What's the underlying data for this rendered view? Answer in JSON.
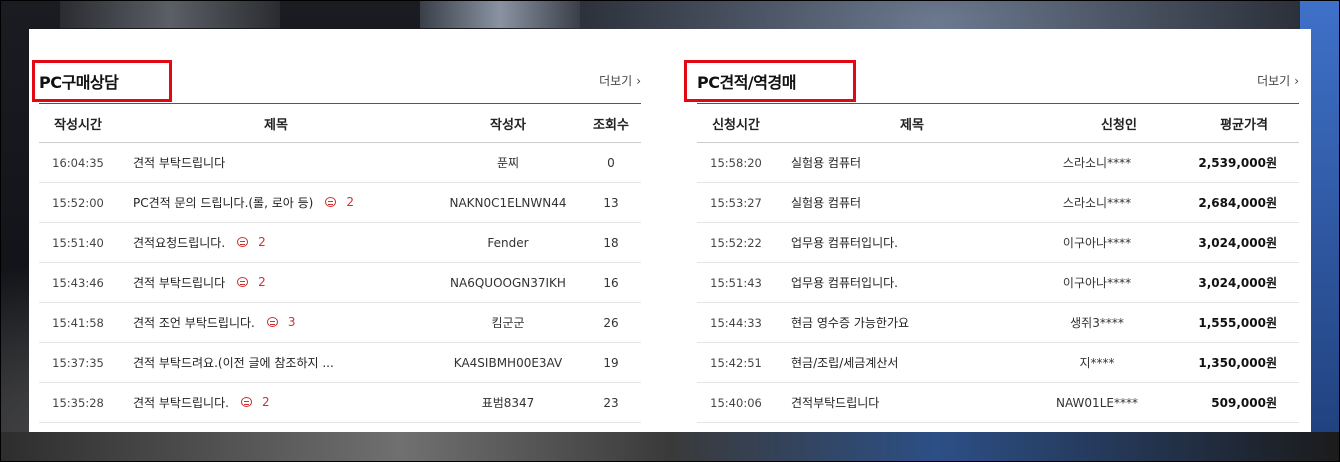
{
  "left_panel": {
    "title": "PC구매상담",
    "more": "더보기",
    "headers": [
      "작성시간",
      "제목",
      "작성자",
      "조회수"
    ],
    "rows": [
      {
        "time": "16:04:35",
        "subject": "견적 부탁드립니다",
        "comments": "",
        "author": "푼찌",
        "views": "0"
      },
      {
        "time": "15:52:00",
        "subject": "PC견적 문의 드립니다.(롤, 로아 등)",
        "comments": "2",
        "author": "NAKN0C1ELNWN44",
        "views": "13"
      },
      {
        "time": "15:51:40",
        "subject": "견적요청드립니다.",
        "comments": "2",
        "author": "Fender",
        "views": "18"
      },
      {
        "time": "15:43:46",
        "subject": "견적 부탁드립니다",
        "comments": "2",
        "author": "NA6QUOOGN37IKH",
        "views": "16"
      },
      {
        "time": "15:41:58",
        "subject": "견적 조언 부탁드립니다.",
        "comments": "3",
        "author": "킴군군",
        "views": "26"
      },
      {
        "time": "15:37:35",
        "subject": "견적 부탁드려요.(이전 글에 참조하지 ...",
        "comments": "",
        "author": "KA4SIBMH00E3AV",
        "views": "19"
      },
      {
        "time": "15:35:28",
        "subject": "견적 부탁드립니다.",
        "comments": "2",
        "author": "표범8347",
        "views": "23"
      }
    ]
  },
  "right_panel": {
    "title": "PC견적/역경매",
    "more": "더보기",
    "headers": [
      "신청시간",
      "제목",
      "신청인",
      "평균가격"
    ],
    "rows": [
      {
        "time": "15:58:20",
        "subject": "실험용 컴퓨터",
        "applicant": "스라소니****",
        "price": "2,539,000원"
      },
      {
        "time": "15:53:27",
        "subject": "실험용 컴퓨터",
        "applicant": "스라소니****",
        "price": "2,684,000원"
      },
      {
        "time": "15:52:22",
        "subject": "업무용 컴퓨터입니다.",
        "applicant": "이구아나****",
        "price": "3,024,000원"
      },
      {
        "time": "15:51:43",
        "subject": "업무용 컴퓨터입니다.",
        "applicant": "이구아나****",
        "price": "3,024,000원"
      },
      {
        "time": "15:44:33",
        "subject": "현금 영수증 가능한가요",
        "applicant": "생쥐3****",
        "price": "1,555,000원"
      },
      {
        "time": "15:42:51",
        "subject": "현금/조립/세금계산서",
        "applicant": "지****",
        "price": "1,350,000원"
      },
      {
        "time": "15:40:06",
        "subject": "견적부탁드립니다",
        "applicant": "NAW01LE****",
        "price": "509,000원"
      }
    ]
  },
  "colors": {
    "highlight": "#e30613",
    "comment": "#d23030"
  }
}
